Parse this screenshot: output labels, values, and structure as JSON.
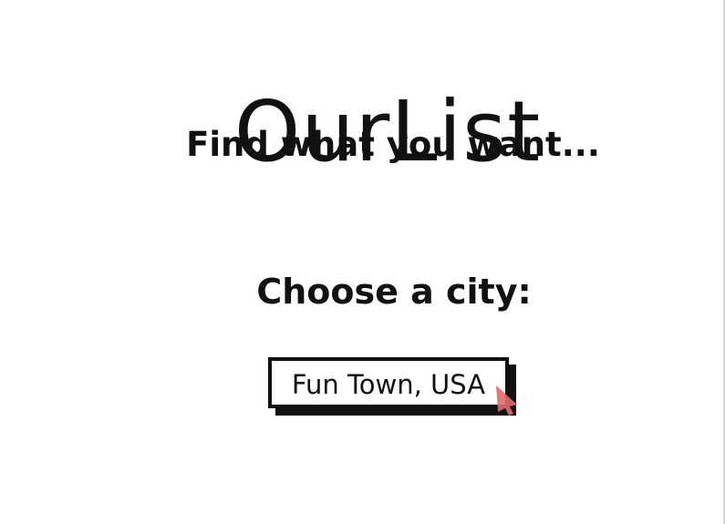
{
  "app": {
    "title": "OurList",
    "tagline": "Find what you want..."
  },
  "city_picker": {
    "prompt": "Choose a city:",
    "selected_city": "Fun Town, USA"
  },
  "colors": {
    "text": "#111111",
    "background": "#ffffff",
    "cursor_accent": "#e06a6a"
  },
  "icons": {
    "cursor": "pointer-cursor-icon"
  }
}
